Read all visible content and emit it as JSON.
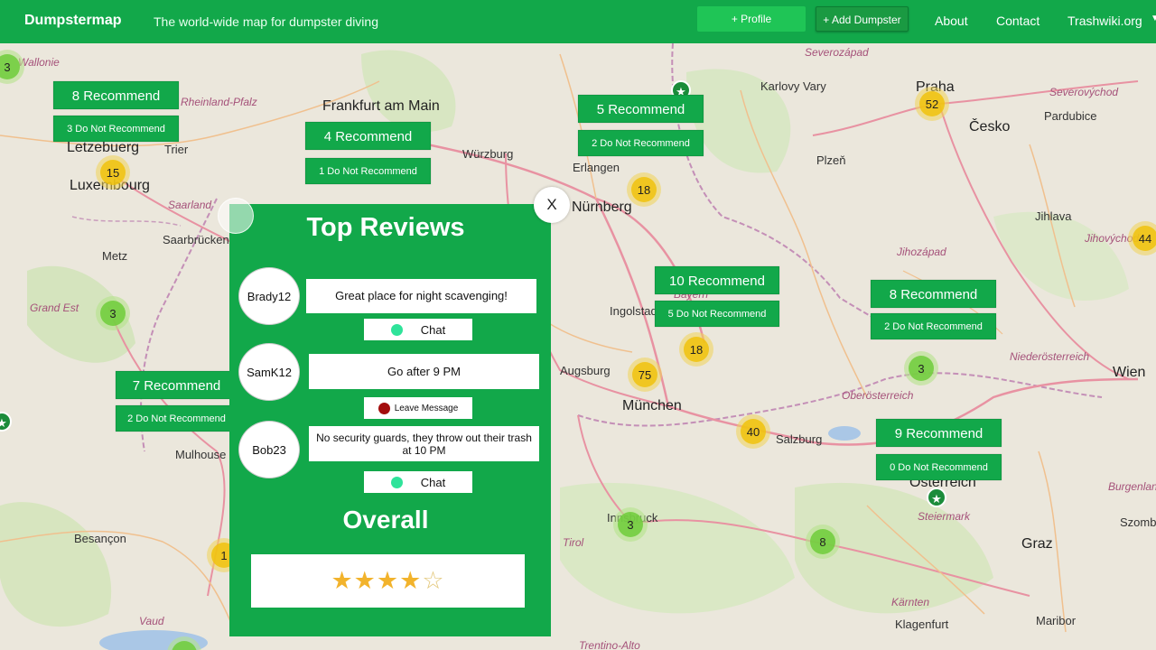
{
  "navbar": {
    "brand": "Dumpstermap",
    "tagline": "The world-wide map for dumpster diving",
    "profile_label": "+ Profile",
    "add_dumpster_label": "+ Add Dumpster",
    "links": [
      "About",
      "Contact",
      "Trashwiki.org"
    ]
  },
  "map": {
    "cities": [
      "Wallonie",
      "Frankfurt am Main",
      "Würzburg",
      "Erlangen",
      "Nürnberg",
      "Karlovy Vary",
      "Severozápad",
      "Praha",
      "Česko",
      "Severovýchod",
      "Pardubice",
      "Rheinland-Pfalz",
      "Trier",
      "Letzebuerg",
      "Luxembourg",
      "Saarland",
      "Saarbrücken",
      "Metz",
      "Grand Est",
      "Plzeň",
      "Jihlava",
      "Jihozápad",
      "Jihovýchod",
      "Bayern",
      "Ingolstadt",
      "Augsburg",
      "München",
      "Salzburg",
      "Niederösterreich",
      "Wien",
      "Oberösterreich",
      "Österreich",
      "Mulhouse",
      "Besançon",
      "Innsbruck",
      "Tirol",
      "Steiermark",
      "Graz",
      "Burgenland",
      "Szomb",
      "Kärnten",
      "Klagenfurt",
      "Maribor",
      "Vaud",
      "Trentino-Alto"
    ],
    "clusters": [
      3,
      15,
      18,
      52,
      3,
      44,
      18,
      75,
      40,
      3,
      3,
      8,
      1
    ],
    "recommendations": [
      {
        "recommend": "8 Recommend",
        "not_recommend": "3 Do Not Recommend"
      },
      {
        "recommend": "4 Recommend",
        "not_recommend": "1 Do Not Recommend"
      },
      {
        "recommend": "5 Recommend",
        "not_recommend": "2 Do Not Recommend"
      },
      {
        "recommend": "10 Recommend",
        "not_recommend": "5 Do Not Recommend"
      },
      {
        "recommend": "8 Recommend",
        "not_recommend": "2 Do Not Recommend"
      },
      {
        "recommend": "7 Recommend",
        "not_recommend": "2 Do Not Recommend"
      },
      {
        "recommend": "9 Recommend",
        "not_recommend": "0 Do Not Recommend"
      }
    ]
  },
  "popup": {
    "title": "Top Reviews",
    "close_label": "X",
    "reviews": [
      {
        "user": "Brady12",
        "text": "Great place for night scavenging!",
        "action": "Chat",
        "status_color": "#2fe39a"
      },
      {
        "user": "SamK12",
        "text": "Go after 9 PM",
        "action": "Leave Message",
        "status_color": "#a30d0d"
      },
      {
        "user": "Bob23",
        "text": "No security guards, they throw out their trash at 10 PM",
        "action": "Chat",
        "status_color": "#2fe39a"
      }
    ],
    "overall_label": "Overall",
    "rating": {
      "value": 4,
      "max": 5
    }
  }
}
